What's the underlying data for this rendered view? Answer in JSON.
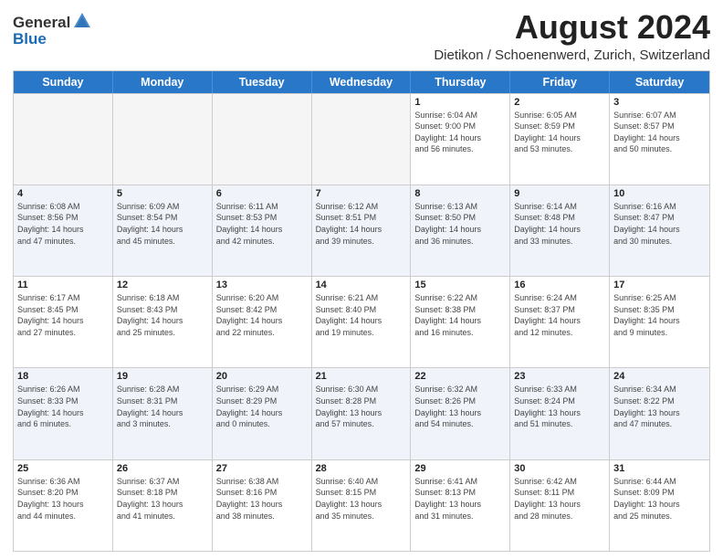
{
  "logo": {
    "general": "General",
    "blue": "Blue"
  },
  "title": "August 2024",
  "subtitle": "Dietikon / Schoenenwerd, Zurich, Switzerland",
  "header_days": [
    "Sunday",
    "Monday",
    "Tuesday",
    "Wednesday",
    "Thursday",
    "Friday",
    "Saturday"
  ],
  "rows": [
    [
      {
        "day": "",
        "info": ""
      },
      {
        "day": "",
        "info": ""
      },
      {
        "day": "",
        "info": ""
      },
      {
        "day": "",
        "info": ""
      },
      {
        "day": "1",
        "info": "Sunrise: 6:04 AM\nSunset: 9:00 PM\nDaylight: 14 hours\nand 56 minutes."
      },
      {
        "day": "2",
        "info": "Sunrise: 6:05 AM\nSunset: 8:59 PM\nDaylight: 14 hours\nand 53 minutes."
      },
      {
        "day": "3",
        "info": "Sunrise: 6:07 AM\nSunset: 8:57 PM\nDaylight: 14 hours\nand 50 minutes."
      }
    ],
    [
      {
        "day": "4",
        "info": "Sunrise: 6:08 AM\nSunset: 8:56 PM\nDaylight: 14 hours\nand 47 minutes."
      },
      {
        "day": "5",
        "info": "Sunrise: 6:09 AM\nSunset: 8:54 PM\nDaylight: 14 hours\nand 45 minutes."
      },
      {
        "day": "6",
        "info": "Sunrise: 6:11 AM\nSunset: 8:53 PM\nDaylight: 14 hours\nand 42 minutes."
      },
      {
        "day": "7",
        "info": "Sunrise: 6:12 AM\nSunset: 8:51 PM\nDaylight: 14 hours\nand 39 minutes."
      },
      {
        "day": "8",
        "info": "Sunrise: 6:13 AM\nSunset: 8:50 PM\nDaylight: 14 hours\nand 36 minutes."
      },
      {
        "day": "9",
        "info": "Sunrise: 6:14 AM\nSunset: 8:48 PM\nDaylight: 14 hours\nand 33 minutes."
      },
      {
        "day": "10",
        "info": "Sunrise: 6:16 AM\nSunset: 8:47 PM\nDaylight: 14 hours\nand 30 minutes."
      }
    ],
    [
      {
        "day": "11",
        "info": "Sunrise: 6:17 AM\nSunset: 8:45 PM\nDaylight: 14 hours\nand 27 minutes."
      },
      {
        "day": "12",
        "info": "Sunrise: 6:18 AM\nSunset: 8:43 PM\nDaylight: 14 hours\nand 25 minutes."
      },
      {
        "day": "13",
        "info": "Sunrise: 6:20 AM\nSunset: 8:42 PM\nDaylight: 14 hours\nand 22 minutes."
      },
      {
        "day": "14",
        "info": "Sunrise: 6:21 AM\nSunset: 8:40 PM\nDaylight: 14 hours\nand 19 minutes."
      },
      {
        "day": "15",
        "info": "Sunrise: 6:22 AM\nSunset: 8:38 PM\nDaylight: 14 hours\nand 16 minutes."
      },
      {
        "day": "16",
        "info": "Sunrise: 6:24 AM\nSunset: 8:37 PM\nDaylight: 14 hours\nand 12 minutes."
      },
      {
        "day": "17",
        "info": "Sunrise: 6:25 AM\nSunset: 8:35 PM\nDaylight: 14 hours\nand 9 minutes."
      }
    ],
    [
      {
        "day": "18",
        "info": "Sunrise: 6:26 AM\nSunset: 8:33 PM\nDaylight: 14 hours\nand 6 minutes."
      },
      {
        "day": "19",
        "info": "Sunrise: 6:28 AM\nSunset: 8:31 PM\nDaylight: 14 hours\nand 3 minutes."
      },
      {
        "day": "20",
        "info": "Sunrise: 6:29 AM\nSunset: 8:29 PM\nDaylight: 14 hours\nand 0 minutes."
      },
      {
        "day": "21",
        "info": "Sunrise: 6:30 AM\nSunset: 8:28 PM\nDaylight: 13 hours\nand 57 minutes."
      },
      {
        "day": "22",
        "info": "Sunrise: 6:32 AM\nSunset: 8:26 PM\nDaylight: 13 hours\nand 54 minutes."
      },
      {
        "day": "23",
        "info": "Sunrise: 6:33 AM\nSunset: 8:24 PM\nDaylight: 13 hours\nand 51 minutes."
      },
      {
        "day": "24",
        "info": "Sunrise: 6:34 AM\nSunset: 8:22 PM\nDaylight: 13 hours\nand 47 minutes."
      }
    ],
    [
      {
        "day": "25",
        "info": "Sunrise: 6:36 AM\nSunset: 8:20 PM\nDaylight: 13 hours\nand 44 minutes."
      },
      {
        "day": "26",
        "info": "Sunrise: 6:37 AM\nSunset: 8:18 PM\nDaylight: 13 hours\nand 41 minutes."
      },
      {
        "day": "27",
        "info": "Sunrise: 6:38 AM\nSunset: 8:16 PM\nDaylight: 13 hours\nand 38 minutes."
      },
      {
        "day": "28",
        "info": "Sunrise: 6:40 AM\nSunset: 8:15 PM\nDaylight: 13 hours\nand 35 minutes."
      },
      {
        "day": "29",
        "info": "Sunrise: 6:41 AM\nSunset: 8:13 PM\nDaylight: 13 hours\nand 31 minutes."
      },
      {
        "day": "30",
        "info": "Sunrise: 6:42 AM\nSunset: 8:11 PM\nDaylight: 13 hours\nand 28 minutes."
      },
      {
        "day": "31",
        "info": "Sunrise: 6:44 AM\nSunset: 8:09 PM\nDaylight: 13 hours\nand 25 minutes."
      }
    ]
  ]
}
